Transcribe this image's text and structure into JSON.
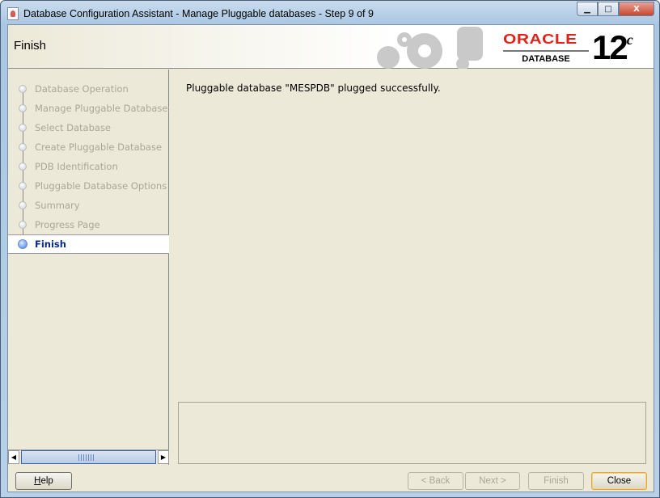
{
  "window": {
    "title": "Database Configuration Assistant - Manage Pluggable databases - Step 9 of 9",
    "minimize": "▁",
    "maximize": "□",
    "close": "X"
  },
  "header": {
    "title": "Finish",
    "logo": {
      "brand": "ORACLE",
      "product": "DATABASE",
      "version": "12",
      "version_suffix": "c"
    }
  },
  "steps": [
    {
      "label": "Database Operation"
    },
    {
      "label": "Manage Pluggable Databases"
    },
    {
      "label": "Select Database"
    },
    {
      "label": "Create Pluggable Database"
    },
    {
      "label": "PDB Identification"
    },
    {
      "label": "Pluggable Database Options"
    },
    {
      "label": "Summary"
    },
    {
      "label": "Progress Page"
    },
    {
      "label": "Finish",
      "active": true
    }
  ],
  "main": {
    "message": "Pluggable database \"MESPDB\" plugged successfully."
  },
  "buttons": {
    "help": "Help",
    "back": "< Back",
    "next": "Next >",
    "finish": "Finish",
    "close": "Close"
  }
}
